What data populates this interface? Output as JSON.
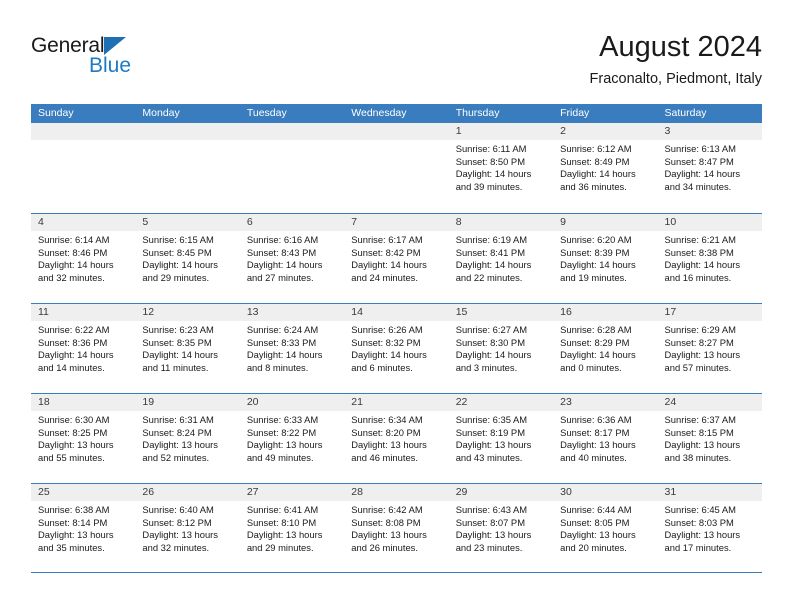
{
  "brand": {
    "name_top": "General",
    "name_bottom": "Blue",
    "triangle_icon": "triangle-icon",
    "accent_color": "#1f7ac4"
  },
  "header": {
    "title": "August 2024",
    "subtitle": "Fraconalto, Piedmont, Italy"
  },
  "theme": {
    "header_blue": "#3a7dbf",
    "day_band_gray": "#efefef"
  },
  "calendar": {
    "weekdays": [
      "Sunday",
      "Monday",
      "Tuesday",
      "Wednesday",
      "Thursday",
      "Friday",
      "Saturday"
    ],
    "weeks": [
      [
        {
          "day": "",
          "sunrise": "",
          "sunset": "",
          "daylight_line1": "",
          "daylight_line2": ""
        },
        {
          "day": "",
          "sunrise": "",
          "sunset": "",
          "daylight_line1": "",
          "daylight_line2": ""
        },
        {
          "day": "",
          "sunrise": "",
          "sunset": "",
          "daylight_line1": "",
          "daylight_line2": ""
        },
        {
          "day": "",
          "sunrise": "",
          "sunset": "",
          "daylight_line1": "",
          "daylight_line2": ""
        },
        {
          "day": "1",
          "sunrise": "Sunrise: 6:11 AM",
          "sunset": "Sunset: 8:50 PM",
          "daylight_line1": "Daylight: 14 hours",
          "daylight_line2": "and 39 minutes."
        },
        {
          "day": "2",
          "sunrise": "Sunrise: 6:12 AM",
          "sunset": "Sunset: 8:49 PM",
          "daylight_line1": "Daylight: 14 hours",
          "daylight_line2": "and 36 minutes."
        },
        {
          "day": "3",
          "sunrise": "Sunrise: 6:13 AM",
          "sunset": "Sunset: 8:47 PM",
          "daylight_line1": "Daylight: 14 hours",
          "daylight_line2": "and 34 minutes."
        }
      ],
      [
        {
          "day": "4",
          "sunrise": "Sunrise: 6:14 AM",
          "sunset": "Sunset: 8:46 PM",
          "daylight_line1": "Daylight: 14 hours",
          "daylight_line2": "and 32 minutes."
        },
        {
          "day": "5",
          "sunrise": "Sunrise: 6:15 AM",
          "sunset": "Sunset: 8:45 PM",
          "daylight_line1": "Daylight: 14 hours",
          "daylight_line2": "and 29 minutes."
        },
        {
          "day": "6",
          "sunrise": "Sunrise: 6:16 AM",
          "sunset": "Sunset: 8:43 PM",
          "daylight_line1": "Daylight: 14 hours",
          "daylight_line2": "and 27 minutes."
        },
        {
          "day": "7",
          "sunrise": "Sunrise: 6:17 AM",
          "sunset": "Sunset: 8:42 PM",
          "daylight_line1": "Daylight: 14 hours",
          "daylight_line2": "and 24 minutes."
        },
        {
          "day": "8",
          "sunrise": "Sunrise: 6:19 AM",
          "sunset": "Sunset: 8:41 PM",
          "daylight_line1": "Daylight: 14 hours",
          "daylight_line2": "and 22 minutes."
        },
        {
          "day": "9",
          "sunrise": "Sunrise: 6:20 AM",
          "sunset": "Sunset: 8:39 PM",
          "daylight_line1": "Daylight: 14 hours",
          "daylight_line2": "and 19 minutes."
        },
        {
          "day": "10",
          "sunrise": "Sunrise: 6:21 AM",
          "sunset": "Sunset: 8:38 PM",
          "daylight_line1": "Daylight: 14 hours",
          "daylight_line2": "and 16 minutes."
        }
      ],
      [
        {
          "day": "11",
          "sunrise": "Sunrise: 6:22 AM",
          "sunset": "Sunset: 8:36 PM",
          "daylight_line1": "Daylight: 14 hours",
          "daylight_line2": "and 14 minutes."
        },
        {
          "day": "12",
          "sunrise": "Sunrise: 6:23 AM",
          "sunset": "Sunset: 8:35 PM",
          "daylight_line1": "Daylight: 14 hours",
          "daylight_line2": "and 11 minutes."
        },
        {
          "day": "13",
          "sunrise": "Sunrise: 6:24 AM",
          "sunset": "Sunset: 8:33 PM",
          "daylight_line1": "Daylight: 14 hours",
          "daylight_line2": "and 8 minutes."
        },
        {
          "day": "14",
          "sunrise": "Sunrise: 6:26 AM",
          "sunset": "Sunset: 8:32 PM",
          "daylight_line1": "Daylight: 14 hours",
          "daylight_line2": "and 6 minutes."
        },
        {
          "day": "15",
          "sunrise": "Sunrise: 6:27 AM",
          "sunset": "Sunset: 8:30 PM",
          "daylight_line1": "Daylight: 14 hours",
          "daylight_line2": "and 3 minutes."
        },
        {
          "day": "16",
          "sunrise": "Sunrise: 6:28 AM",
          "sunset": "Sunset: 8:29 PM",
          "daylight_line1": "Daylight: 14 hours",
          "daylight_line2": "and 0 minutes."
        },
        {
          "day": "17",
          "sunrise": "Sunrise: 6:29 AM",
          "sunset": "Sunset: 8:27 PM",
          "daylight_line1": "Daylight: 13 hours",
          "daylight_line2": "and 57 minutes."
        }
      ],
      [
        {
          "day": "18",
          "sunrise": "Sunrise: 6:30 AM",
          "sunset": "Sunset: 8:25 PM",
          "daylight_line1": "Daylight: 13 hours",
          "daylight_line2": "and 55 minutes."
        },
        {
          "day": "19",
          "sunrise": "Sunrise: 6:31 AM",
          "sunset": "Sunset: 8:24 PM",
          "daylight_line1": "Daylight: 13 hours",
          "daylight_line2": "and 52 minutes."
        },
        {
          "day": "20",
          "sunrise": "Sunrise: 6:33 AM",
          "sunset": "Sunset: 8:22 PM",
          "daylight_line1": "Daylight: 13 hours",
          "daylight_line2": "and 49 minutes."
        },
        {
          "day": "21",
          "sunrise": "Sunrise: 6:34 AM",
          "sunset": "Sunset: 8:20 PM",
          "daylight_line1": "Daylight: 13 hours",
          "daylight_line2": "and 46 minutes."
        },
        {
          "day": "22",
          "sunrise": "Sunrise: 6:35 AM",
          "sunset": "Sunset: 8:19 PM",
          "daylight_line1": "Daylight: 13 hours",
          "daylight_line2": "and 43 minutes."
        },
        {
          "day": "23",
          "sunrise": "Sunrise: 6:36 AM",
          "sunset": "Sunset: 8:17 PM",
          "daylight_line1": "Daylight: 13 hours",
          "daylight_line2": "and 40 minutes."
        },
        {
          "day": "24",
          "sunrise": "Sunrise: 6:37 AM",
          "sunset": "Sunset: 8:15 PM",
          "daylight_line1": "Daylight: 13 hours",
          "daylight_line2": "and 38 minutes."
        }
      ],
      [
        {
          "day": "25",
          "sunrise": "Sunrise: 6:38 AM",
          "sunset": "Sunset: 8:14 PM",
          "daylight_line1": "Daylight: 13 hours",
          "daylight_line2": "and 35 minutes."
        },
        {
          "day": "26",
          "sunrise": "Sunrise: 6:40 AM",
          "sunset": "Sunset: 8:12 PM",
          "daylight_line1": "Daylight: 13 hours",
          "daylight_line2": "and 32 minutes."
        },
        {
          "day": "27",
          "sunrise": "Sunrise: 6:41 AM",
          "sunset": "Sunset: 8:10 PM",
          "daylight_line1": "Daylight: 13 hours",
          "daylight_line2": "and 29 minutes."
        },
        {
          "day": "28",
          "sunrise": "Sunrise: 6:42 AM",
          "sunset": "Sunset: 8:08 PM",
          "daylight_line1": "Daylight: 13 hours",
          "daylight_line2": "and 26 minutes."
        },
        {
          "day": "29",
          "sunrise": "Sunrise: 6:43 AM",
          "sunset": "Sunset: 8:07 PM",
          "daylight_line1": "Daylight: 13 hours",
          "daylight_line2": "and 23 minutes."
        },
        {
          "day": "30",
          "sunrise": "Sunrise: 6:44 AM",
          "sunset": "Sunset: 8:05 PM",
          "daylight_line1": "Daylight: 13 hours",
          "daylight_line2": "and 20 minutes."
        },
        {
          "day": "31",
          "sunrise": "Sunrise: 6:45 AM",
          "sunset": "Sunset: 8:03 PM",
          "daylight_line1": "Daylight: 13 hours",
          "daylight_line2": "and 17 minutes."
        }
      ]
    ]
  }
}
